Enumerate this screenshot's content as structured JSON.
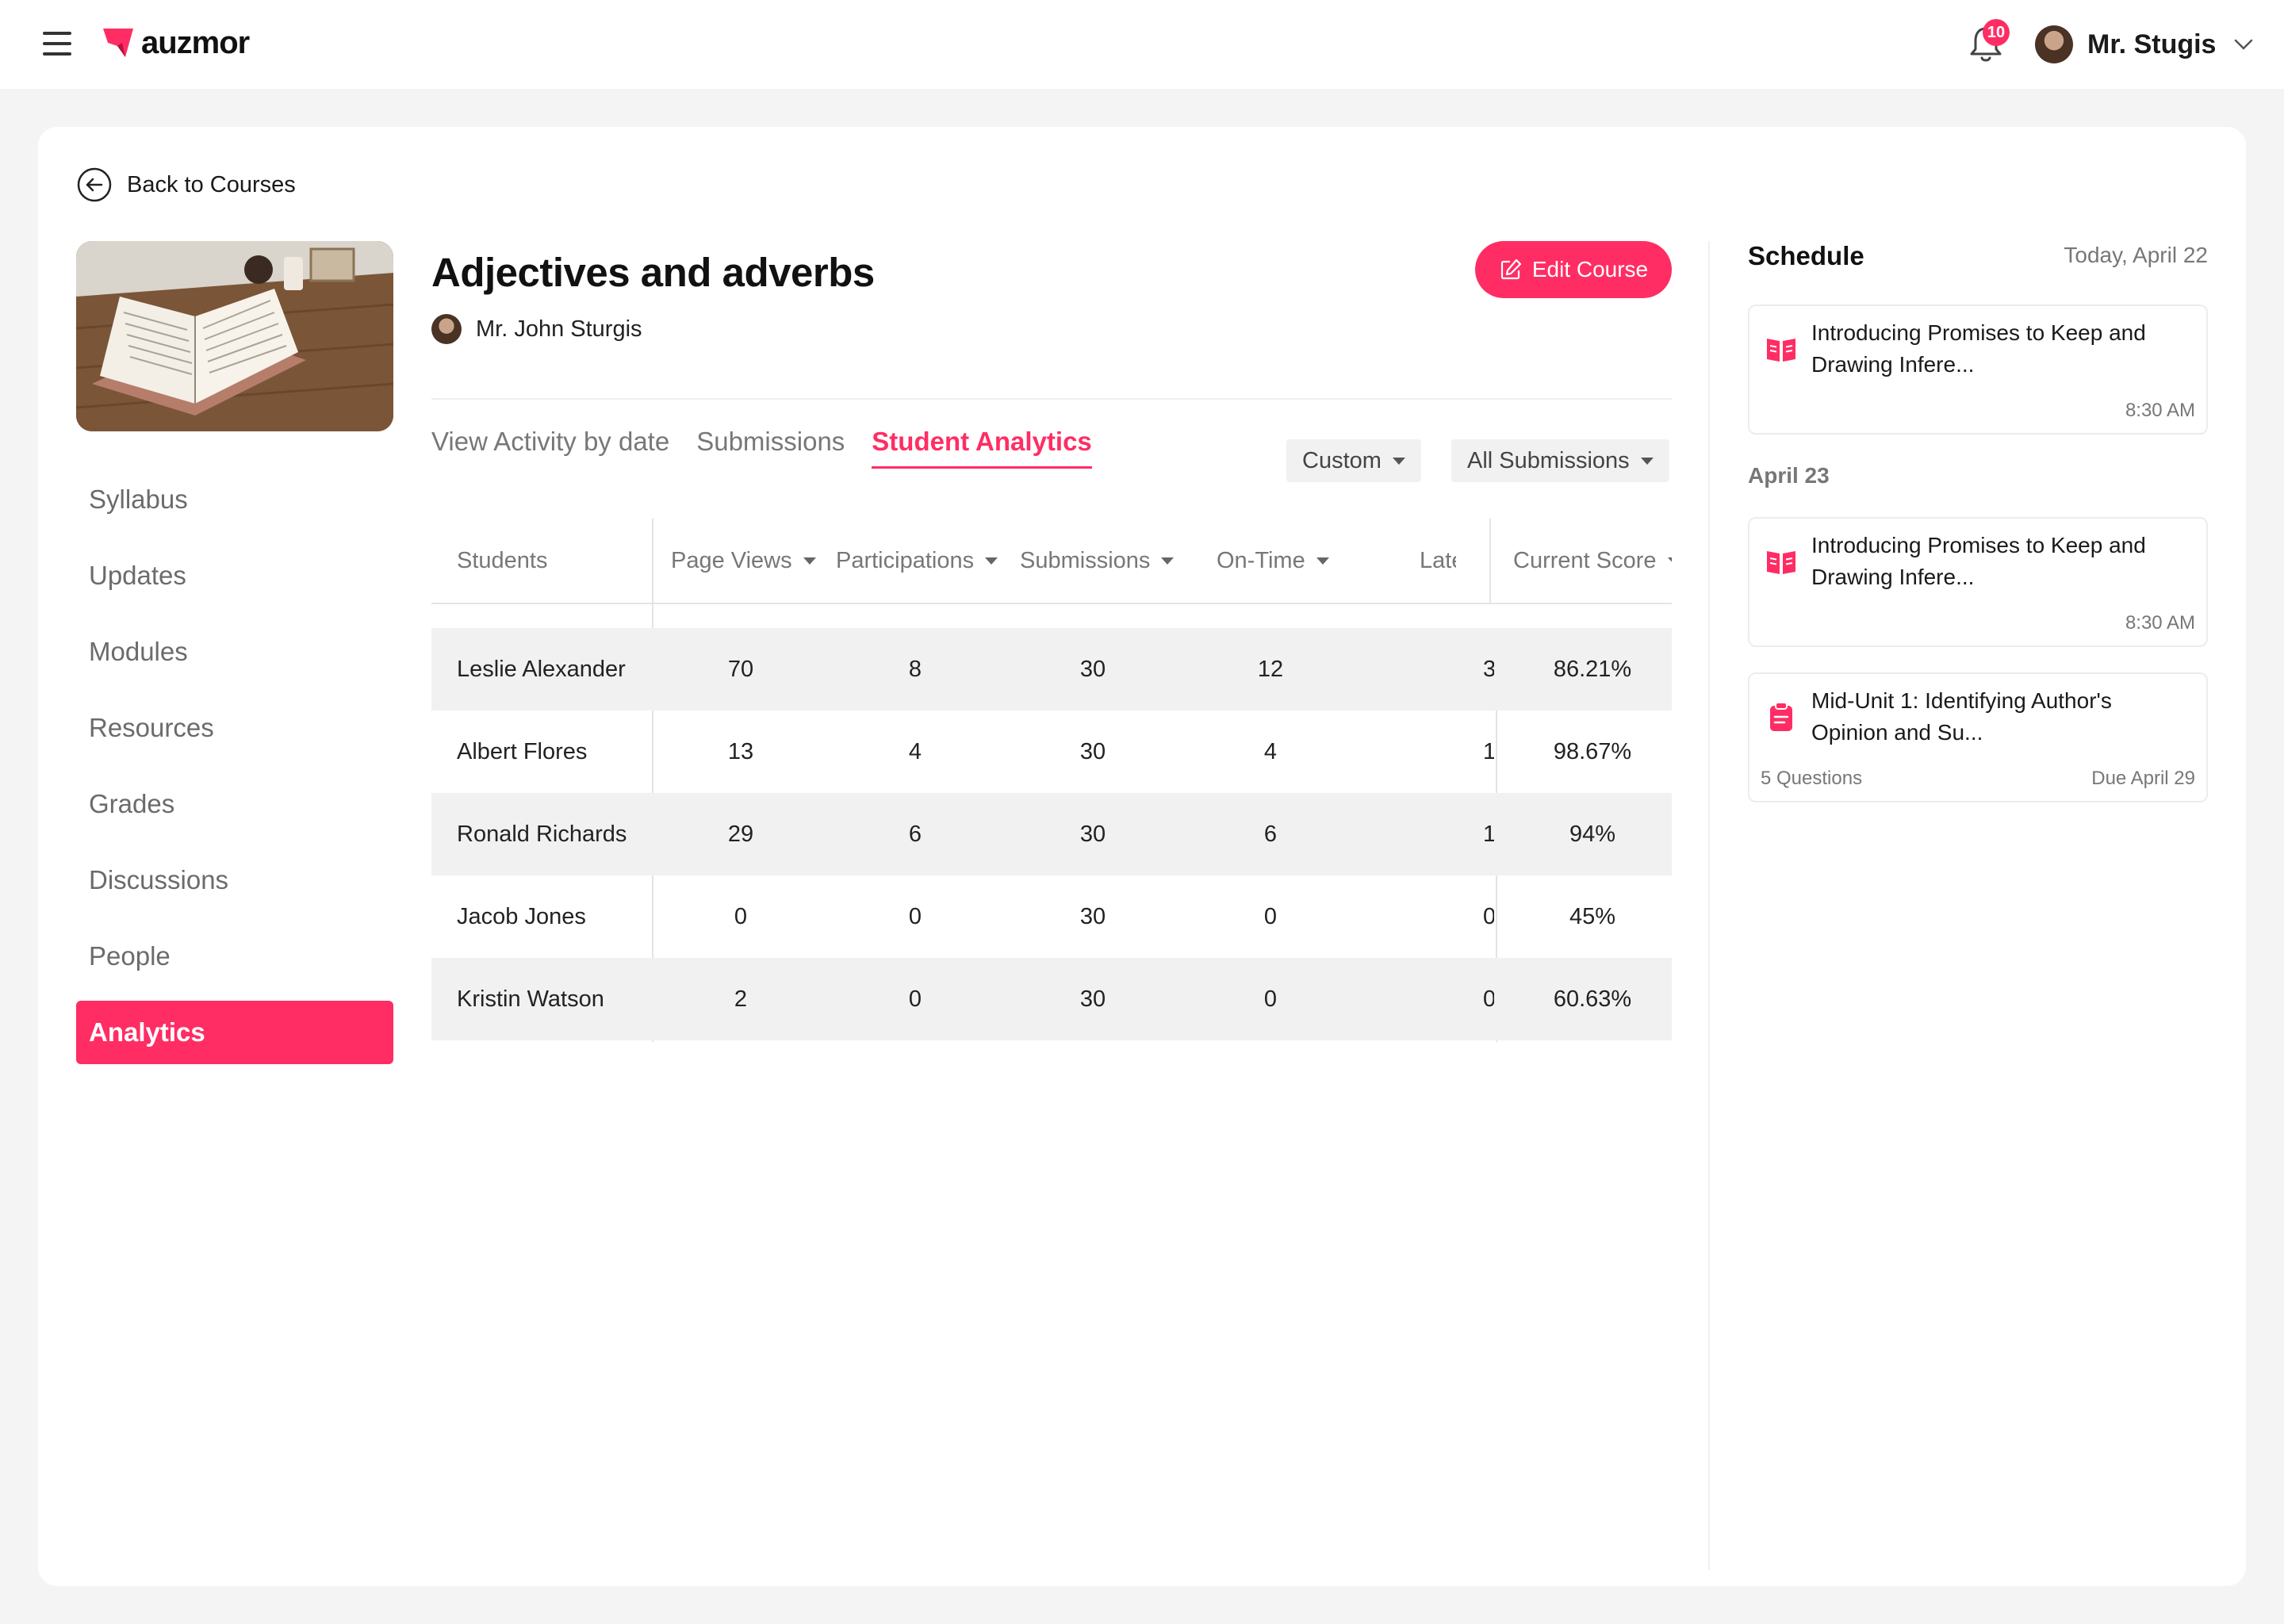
{
  "app": {
    "brand": "auzmor"
  },
  "header": {
    "notification_count": "10",
    "user_name": "Mr. Stugis"
  },
  "back_label": "Back to Courses",
  "nav": {
    "items": [
      "Syllabus",
      "Updates",
      "Modules",
      "Resources",
      "Grades",
      "Discussions",
      "People",
      "Analytics"
    ],
    "active": "Analytics"
  },
  "course": {
    "title": "Adjectives and adverbs",
    "instructor": "Mr. John Sturgis",
    "edit_label": "Edit Course"
  },
  "tabs": [
    "View Activity by date",
    "Submissions",
    "Student Analytics"
  ],
  "active_tab": "Student Analytics",
  "filters": {
    "range": "Custom",
    "submissions": "All Submissions"
  },
  "table": {
    "columns": [
      "Students",
      "Page Views",
      "Participations",
      "Submissions",
      "On-Time",
      "Late",
      "Current Score"
    ],
    "rows": [
      [
        "Leslie Alexander",
        "70",
        "8",
        "30",
        "12",
        "3",
        "86.21%"
      ],
      [
        "Albert Flores",
        "13",
        "4",
        "30",
        "4",
        "1",
        "98.67%"
      ],
      [
        "Ronald Richards",
        "29",
        "6",
        "30",
        "6",
        "1",
        "94%"
      ],
      [
        "Jacob Jones",
        "0",
        "0",
        "30",
        "0",
        "0",
        "45%"
      ],
      [
        "Kristin Watson",
        "2",
        "0",
        "30",
        "0",
        "0",
        "60.63%"
      ]
    ]
  },
  "schedule": {
    "title": "Schedule",
    "today_label": "Today, April 22",
    "group2_label": "April 23",
    "items": [
      {
        "title": "Introducing Promises to Keep and Drawing Infere...",
        "time": "8:30 AM"
      },
      {
        "title": "Introducing Promises to Keep and Drawing Infere...",
        "time": "8:30 AM"
      },
      {
        "title": "Mid-Unit 1: Identifying Author's Opinion and Su...",
        "meta": "5 Questions",
        "due": "Due April 29"
      }
    ]
  },
  "colors": {
    "accent": "#ff2d64",
    "row_shade": "#f1f1f1",
    "muted_text": "#777777"
  },
  "icons": [
    "menu-icon",
    "bell-icon",
    "chevron-down-icon",
    "back-arrow-icon",
    "edit-icon",
    "book-icon",
    "clipboard-icon"
  ]
}
